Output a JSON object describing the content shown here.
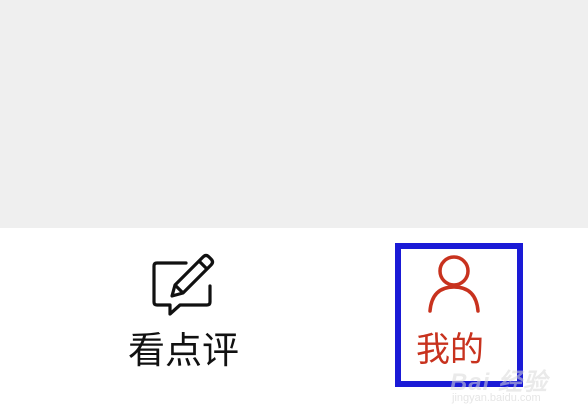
{
  "tabbar": {
    "review": {
      "label": "看点评",
      "icon": "edit-comment-icon"
    },
    "me": {
      "label": "我的",
      "icon": "user-icon"
    }
  },
  "colors": {
    "content_background": "#efefef",
    "tabbar_background": "#ffffff",
    "active_tab": "#c8321e",
    "inactive_tab": "#111111",
    "highlight_border": "#1a1ad6"
  },
  "watermark": {
    "logo": "Bai 经验",
    "sub": "jingyan.baidu.com"
  }
}
